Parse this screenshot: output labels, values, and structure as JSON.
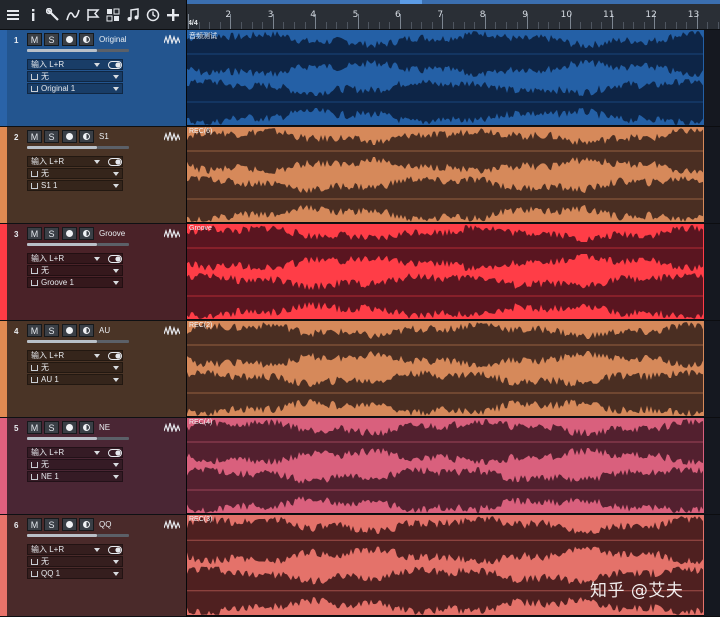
{
  "toolbar": {
    "tools": [
      {
        "icon": "menu-icon"
      },
      {
        "icon": "info-icon"
      },
      {
        "icon": "wrench-icon"
      },
      {
        "icon": "automation-curve-icon"
      },
      {
        "icon": "flag-icon"
      },
      {
        "icon": "grid-icon"
      },
      {
        "icon": "music-note-icon"
      },
      {
        "icon": "clock-icon"
      },
      {
        "icon": "add-icon"
      }
    ]
  },
  "ruler": {
    "time_signature": "4/4",
    "bars": [
      "2",
      "3",
      "4",
      "5",
      "6",
      "7",
      "8",
      "9",
      "10",
      "11",
      "12",
      "13"
    ]
  },
  "tracks": [
    {
      "number": "1",
      "name": "Original",
      "input": "输入 L+R",
      "fx": "无",
      "output": "Original 1",
      "clip": "音频测试",
      "color": "#2a63a8",
      "header_bg": "#23558f",
      "wave_fill": "#0d2547",
      "wave_bg": "#2460a6",
      "selected": true
    },
    {
      "number": "2",
      "name": "S1",
      "input": "输入 L+R",
      "fx": "无",
      "output": "S1 1",
      "clip": "REC(6)",
      "color": "#e08a52",
      "header_bg": "#4a3426",
      "wave_fill": "#4a2e22",
      "wave_bg": "#d6895a",
      "selected": false
    },
    {
      "number": "3",
      "name": "Groove",
      "input": "输入 L+R",
      "fx": "无",
      "output": "Groove 1",
      "clip": "Groove",
      "color": "#ff3b45",
      "header_bg": "#4a2228",
      "wave_fill": "#5a1520",
      "wave_bg": "#ff3d47",
      "selected": false
    },
    {
      "number": "4",
      "name": "AU",
      "input": "输入 L+R",
      "fx": "无",
      "output": "AU 1",
      "clip": "REC(2)",
      "color": "#e08a52",
      "header_bg": "#4a3426",
      "wave_fill": "#4a2e22",
      "wave_bg": "#d6895a",
      "selected": false
    },
    {
      "number": "5",
      "name": "NE",
      "input": "输入 L+R",
      "fx": "无",
      "output": "NE 1",
      "clip": "REC(4)",
      "color": "#e0607e",
      "header_bg": "#4a2634",
      "wave_fill": "#53202f",
      "wave_bg": "#d9607d",
      "selected": false
    },
    {
      "number": "6",
      "name": "QQ",
      "input": "输入 L+R",
      "fx": "无",
      "output": "QQ 1",
      "clip": "REC(3)",
      "color": "#e8736a",
      "header_bg": "#4a2a2a",
      "wave_fill": "#4f2020",
      "wave_bg": "#e4726a",
      "selected": false
    }
  ],
  "button_labels": {
    "mute": "M",
    "solo": "S"
  },
  "watermark": "知乎 @艾夫"
}
